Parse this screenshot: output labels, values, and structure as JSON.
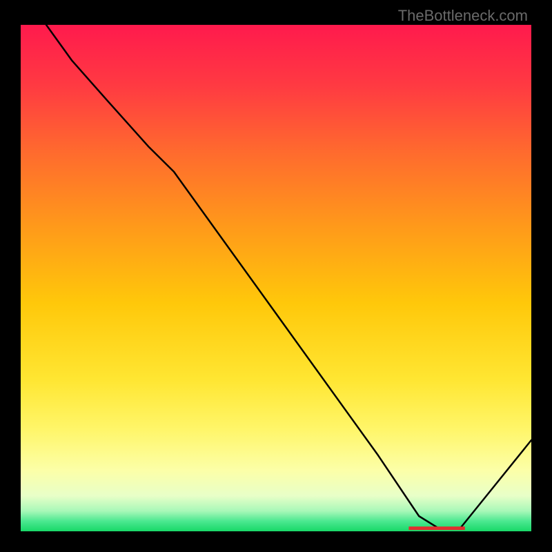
{
  "attribution": "TheBottleneck.com",
  "chart_data": {
    "type": "line",
    "title": "",
    "xlabel": "",
    "ylabel": "",
    "xlim": [
      0,
      100
    ],
    "ylim": [
      0,
      100
    ],
    "series": [
      {
        "name": "curve",
        "x": [
          5,
          10,
          17,
          25,
          30,
          50,
          70,
          78,
          82,
          86,
          88,
          100
        ],
        "values": [
          100,
          93,
          85,
          76,
          71,
          43,
          15,
          3,
          0.5,
          0.5,
          3,
          18
        ]
      }
    ],
    "marker": {
      "x_start": 76,
      "x_end": 87,
      "y": 0.6,
      "color": "#e03030"
    },
    "gradient_stops": [
      {
        "offset": 0,
        "color": "#ff1a4d"
      },
      {
        "offset": 12,
        "color": "#ff3a42"
      },
      {
        "offset": 25,
        "color": "#ff6a2e"
      },
      {
        "offset": 40,
        "color": "#ff9a1a"
      },
      {
        "offset": 55,
        "color": "#ffc80a"
      },
      {
        "offset": 70,
        "color": "#ffe632"
      },
      {
        "offset": 80,
        "color": "#fff66a"
      },
      {
        "offset": 88,
        "color": "#fcffa8"
      },
      {
        "offset": 93,
        "color": "#e8ffc8"
      },
      {
        "offset": 96,
        "color": "#a8f8b8"
      },
      {
        "offset": 98,
        "color": "#4be890"
      },
      {
        "offset": 100,
        "color": "#18d868"
      }
    ]
  }
}
